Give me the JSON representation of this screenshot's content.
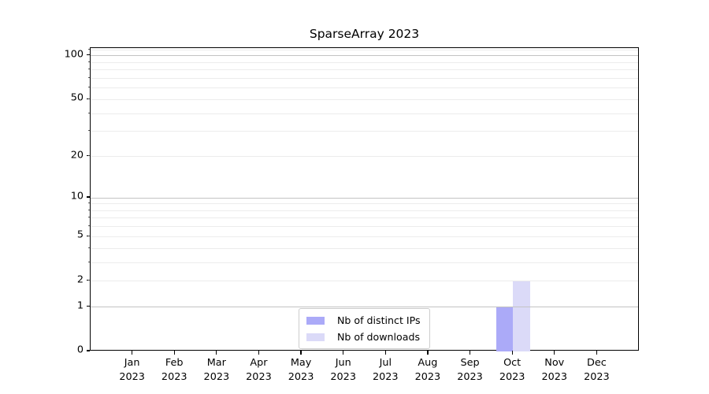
{
  "figure": {
    "background": "#ffffff"
  },
  "chart_data": {
    "type": "bar",
    "title": "SparseArray 2023",
    "months": [
      "Jan",
      "Feb",
      "Mar",
      "Apr",
      "May",
      "Jun",
      "Jul",
      "Aug",
      "Sep",
      "Oct",
      "Nov",
      "Dec"
    ],
    "year": "2023",
    "series": [
      {
        "id": "distinct-ips",
        "name": "Nb of distinct IPs",
        "color": "#abaaf8",
        "values": [
          0,
          0,
          0,
          0,
          0,
          0,
          0,
          0,
          0,
          1,
          0,
          0
        ]
      },
      {
        "id": "downloads",
        "name": "Nb of downloads",
        "color": "#dbdaf8",
        "values": [
          0,
          0,
          0,
          0,
          0,
          0,
          0,
          0,
          0,
          2,
          0,
          0
        ]
      }
    ],
    "yscale": "log1p",
    "ylim": [
      0,
      113
    ],
    "yticks": [
      0,
      1,
      2,
      5,
      10,
      20,
      50,
      100
    ],
    "major_gridlines": [
      1,
      10,
      100
    ],
    "minor_gridlines": [
      2,
      3,
      4,
      5,
      6,
      7,
      8,
      9,
      20,
      30,
      40,
      50,
      60,
      70,
      80,
      90,
      110
    ],
    "grid": "on",
    "legend_position": "lower center inside"
  },
  "colors": {
    "major_grid": "#c3c3c3",
    "minor_grid": "#ececec",
    "axis": "#000000",
    "legend_border": "#cccccc",
    "text": "#000000"
  }
}
